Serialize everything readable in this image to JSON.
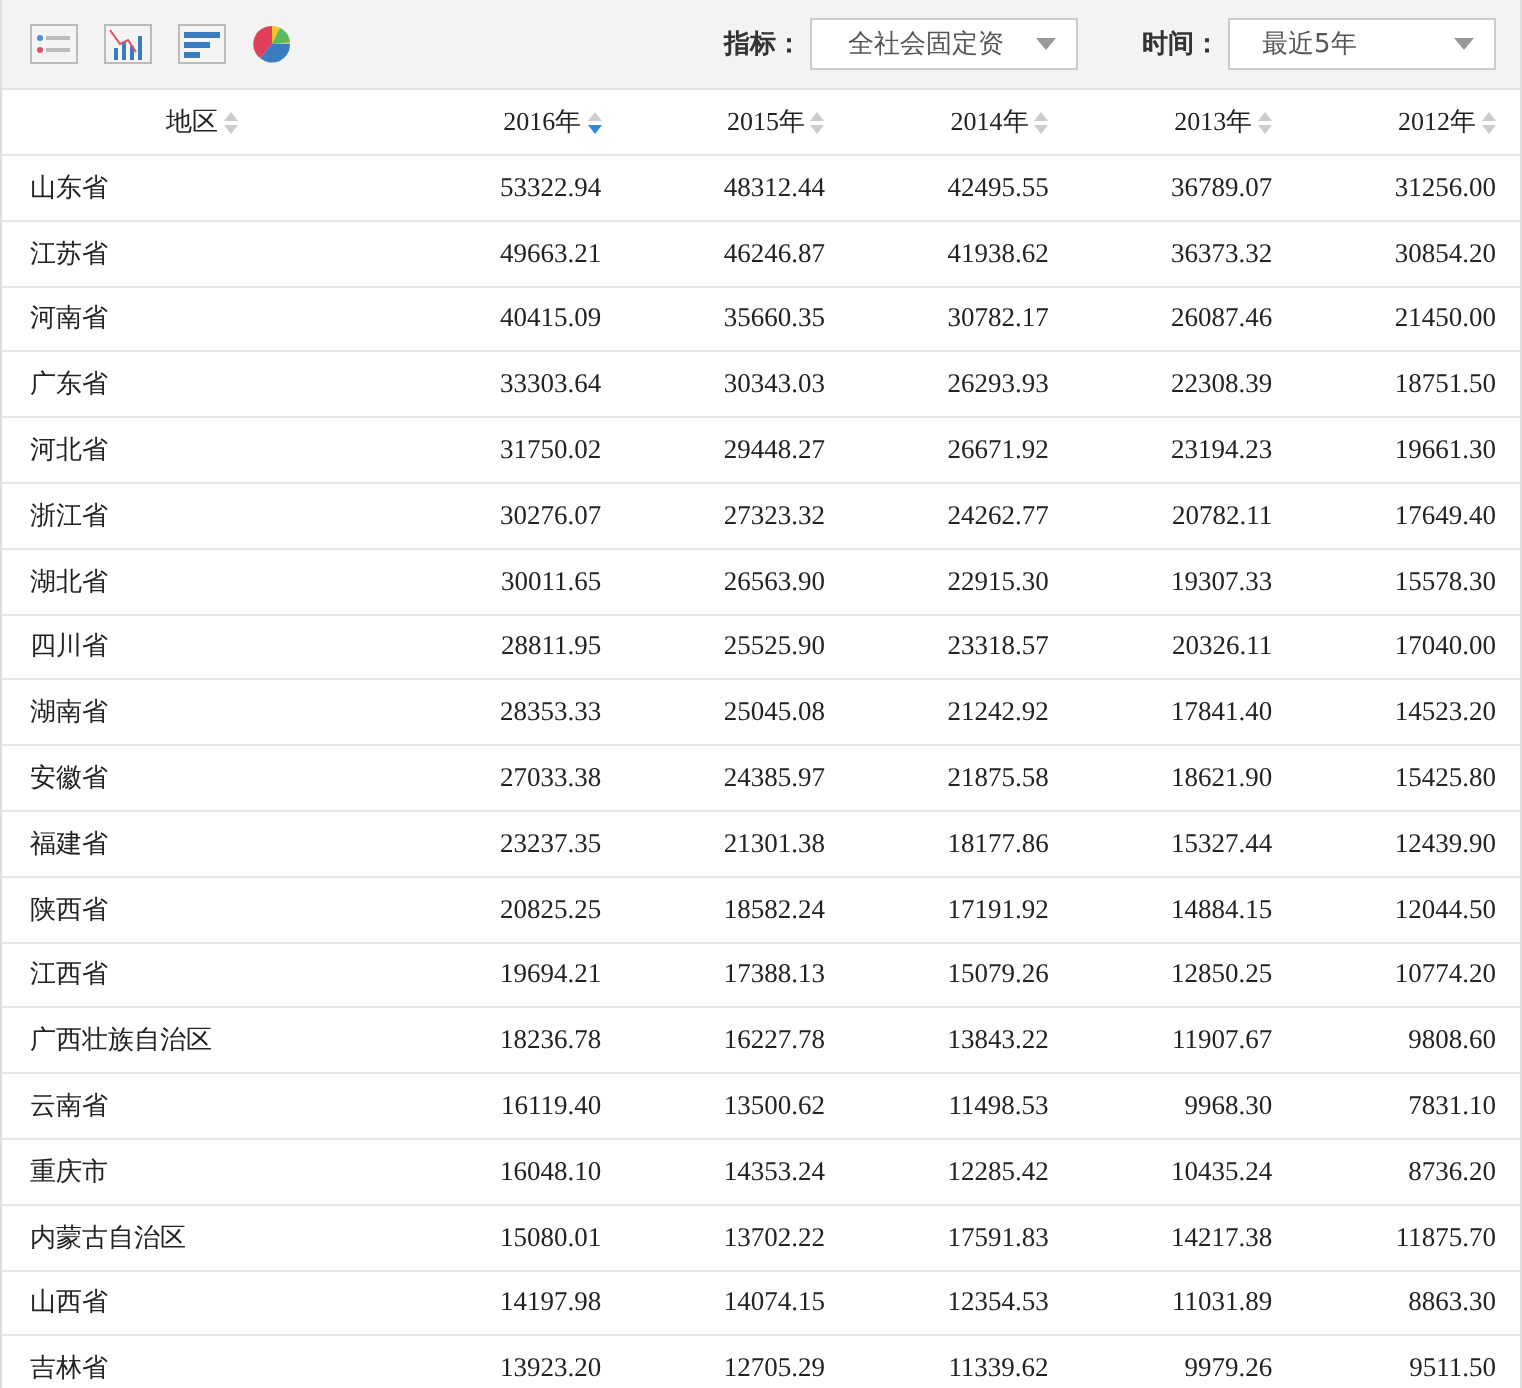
{
  "toolbar": {
    "filters": [
      {
        "label": "指标：",
        "value": "全社会固定资"
      },
      {
        "label": "时间：",
        "value": "最近5年"
      }
    ]
  },
  "table": {
    "columns": [
      {
        "label": "地区",
        "sorted": false
      },
      {
        "label": "2016年",
        "sorted": true
      },
      {
        "label": "2015年",
        "sorted": false
      },
      {
        "label": "2014年",
        "sorted": false
      },
      {
        "label": "2013年",
        "sorted": false
      },
      {
        "label": "2012年",
        "sorted": false
      }
    ],
    "rows": [
      [
        "山东省",
        "53322.94",
        "48312.44",
        "42495.55",
        "36789.07",
        "31256.00"
      ],
      [
        "江苏省",
        "49663.21",
        "46246.87",
        "41938.62",
        "36373.32",
        "30854.20"
      ],
      [
        "河南省",
        "40415.09",
        "35660.35",
        "30782.17",
        "26087.46",
        "21450.00"
      ],
      [
        "广东省",
        "33303.64",
        "30343.03",
        "26293.93",
        "22308.39",
        "18751.50"
      ],
      [
        "河北省",
        "31750.02",
        "29448.27",
        "26671.92",
        "23194.23",
        "19661.30"
      ],
      [
        "浙江省",
        "30276.07",
        "27323.32",
        "24262.77",
        "20782.11",
        "17649.40"
      ],
      [
        "湖北省",
        "30011.65",
        "26563.90",
        "22915.30",
        "19307.33",
        "15578.30"
      ],
      [
        "四川省",
        "28811.95",
        "25525.90",
        "23318.57",
        "20326.11",
        "17040.00"
      ],
      [
        "湖南省",
        "28353.33",
        "25045.08",
        "21242.92",
        "17841.40",
        "14523.20"
      ],
      [
        "安徽省",
        "27033.38",
        "24385.97",
        "21875.58",
        "18621.90",
        "15425.80"
      ],
      [
        "福建省",
        "23237.35",
        "21301.38",
        "18177.86",
        "15327.44",
        "12439.90"
      ],
      [
        "陕西省",
        "20825.25",
        "18582.24",
        "17191.92",
        "14884.15",
        "12044.50"
      ],
      [
        "江西省",
        "19694.21",
        "17388.13",
        "15079.26",
        "12850.25",
        "10774.20"
      ],
      [
        "广西壮族自治区",
        "18236.78",
        "16227.78",
        "13843.22",
        "11907.67",
        "9808.60"
      ],
      [
        "云南省",
        "16119.40",
        "13500.62",
        "11498.53",
        "9968.30",
        "7831.10"
      ],
      [
        "重庆市",
        "16048.10",
        "14353.24",
        "12285.42",
        "10435.24",
        "8736.20"
      ],
      [
        "内蒙古自治区",
        "15080.01",
        "13702.22",
        "17591.83",
        "14217.38",
        "11875.70"
      ],
      [
        "山西省",
        "14197.98",
        "14074.15",
        "12354.53",
        "11031.89",
        "8863.30"
      ],
      [
        "吉林省",
        "13923.20",
        "12705.29",
        "11339.62",
        "9979.26",
        "9511.50"
      ]
    ]
  }
}
